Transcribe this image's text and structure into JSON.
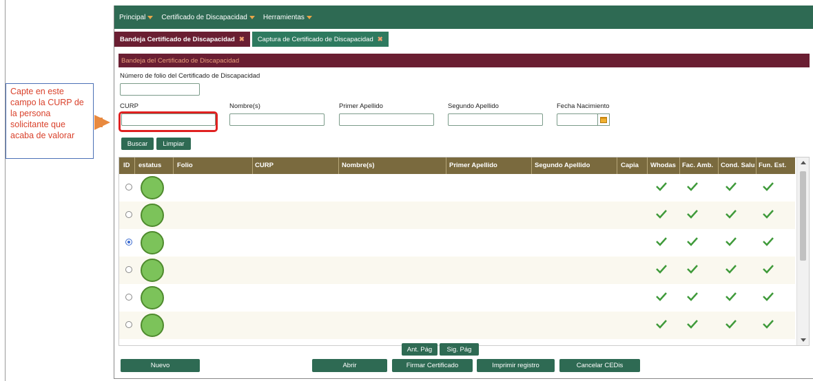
{
  "nav": {
    "items": [
      {
        "label": "Principal"
      },
      {
        "label": "Certificado de Discapacidad"
      },
      {
        "label": "Herramientas"
      }
    ]
  },
  "tabs": [
    {
      "label": "Bandeja Certificado de Discapacidad",
      "close": "✖"
    },
    {
      "label": "Captura de Certificado de Discapacidad",
      "close": "✖"
    }
  ],
  "panel": {
    "title": "Bandeja del Certificado de Discapacidad",
    "folio_label": "Número de folio del Certificado de Discapacidad",
    "curp_label": "CURP",
    "nombre_label": "Nombre(s)",
    "primer_apellido_label": "Primer Apellido",
    "segundo_apellido_label": "Segundo Apellido",
    "fecha_label": "Fecha Nacimiento",
    "buscar": "Buscar",
    "limpiar": "Limpiar"
  },
  "grid": {
    "columns": [
      "ID",
      "estatus",
      "Folio",
      "CURP",
      "Nombre(s)",
      "Primer Apellido",
      "Segundo Apellido",
      "Capia",
      "Whodas",
      "Fac. Amb.",
      "Cond. Salu",
      "Fun. Est."
    ],
    "rows": [
      {
        "selected": false
      },
      {
        "selected": false
      },
      {
        "selected": true
      },
      {
        "selected": false
      },
      {
        "selected": false
      },
      {
        "selected": false
      }
    ],
    "status_color": "#7cc35a",
    "check_color": "#3f9a3a"
  },
  "pager": {
    "prev": "Ant. Pág",
    "next": "Sig. Pág"
  },
  "actions": {
    "nuevo": "Nuevo",
    "abrir": "Abrir",
    "firmar": "Firmar Certificado",
    "imprimir": "Imprimir registro",
    "cancelar": "Cancelar CEDis"
  },
  "callout": {
    "text": "Capte en este campo la CURP de la persona solicitante que acaba de valorar"
  },
  "colors": {
    "nav_green": "#2e6a53",
    "tab_maroon": "#6a1e32",
    "header_gold": "#7a6a3e",
    "callout_red": "#d9412b",
    "arrow_orange": "#e8893f"
  }
}
